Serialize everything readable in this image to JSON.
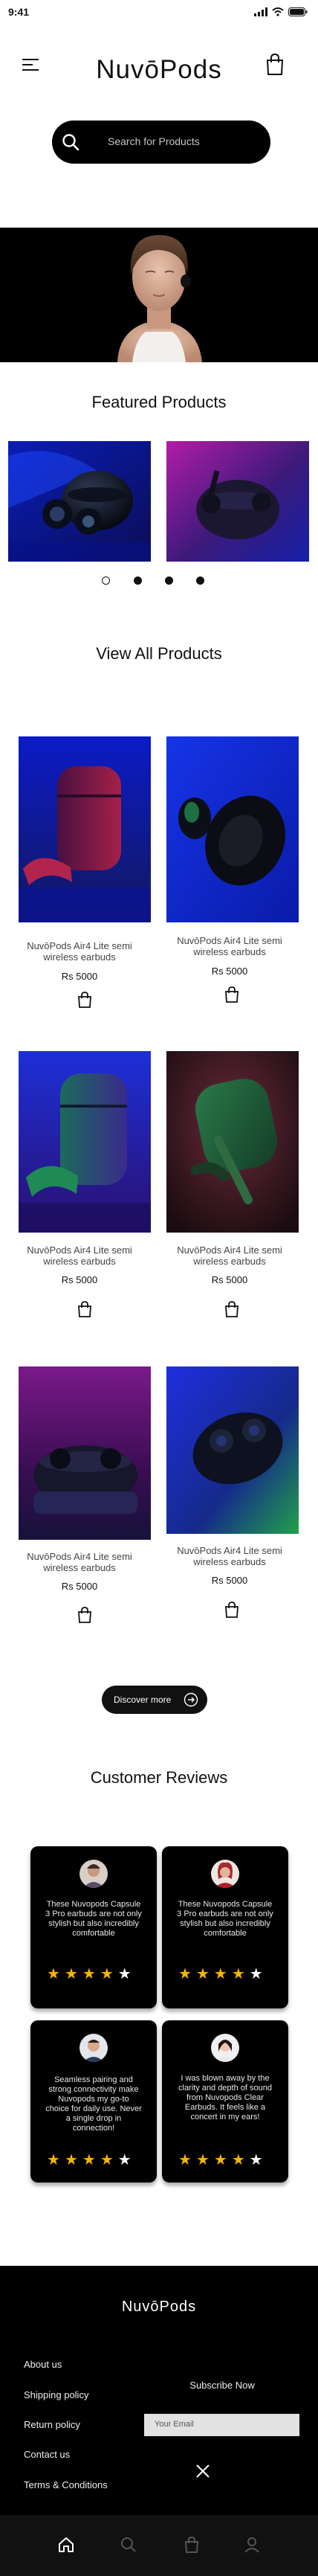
{
  "status_bar": {
    "time": "9:41"
  },
  "header": {
    "brand": "NuvōPods"
  },
  "search": {
    "placeholder": "Search for Products"
  },
  "featured": {
    "title": "Featured Products"
  },
  "view_all": {
    "title": "View All Products"
  },
  "products": [
    {
      "name": "NuvōPods Air4 Lite semi wireless earbuds",
      "price": "Rs 5000"
    },
    {
      "name": "NuvōPods Air4 Lite semi wireless earbuds",
      "price": "Rs 5000"
    },
    {
      "name": "NuvōPods Air4 Lite semi wireless earbuds",
      "price": "Rs 5000"
    },
    {
      "name": "NuvōPods Air4 Lite semi wireless earbuds",
      "price": "Rs 5000"
    },
    {
      "name": "NuvōPods Air4 Lite semi wireless earbuds",
      "price": "Rs 5000"
    },
    {
      "name": "NuvōPods Air4 Lite semi wireless earbuds",
      "price": "Rs 5000"
    }
  ],
  "discover": {
    "label": "Discover more"
  },
  "reviews": {
    "title": "Customer Reviews",
    "items": [
      {
        "text": "These Nuvopods Capsule 3 Pro earbuds are not only stylish but also incredibly comfortable",
        "rating": 4
      },
      {
        "text": "These Nuvopods Capsule 3 Pro earbuds are not only stylish but also incredibly comfortable",
        "rating": 4
      },
      {
        "text": "Seamless pairing and strong connectivity make Nuvopods my go-to choice for daily use. Never a single drop in connection!",
        "rating": 4
      },
      {
        "text": "I was blown away by the clarity and depth of sound from Nuvopods Clear Earbuds. It feels like a concert in my ears!",
        "rating": 4
      }
    ]
  },
  "footer": {
    "brand": "NuvōPods",
    "links": [
      "About us",
      "Shipping policy",
      "Return policy",
      "Contact us",
      "Terms & Conditions"
    ],
    "subscribe_title": "Subscribe Now",
    "email_placeholder": "Your Email"
  },
  "nav": {
    "items": [
      "home-icon",
      "search-icon",
      "bag-icon",
      "profile-icon"
    ]
  },
  "colors": {
    "star": "#f5b400",
    "black": "#000000",
    "accent_blue": "#1a2bd6",
    "accent_purple": "#5a1c8a"
  }
}
